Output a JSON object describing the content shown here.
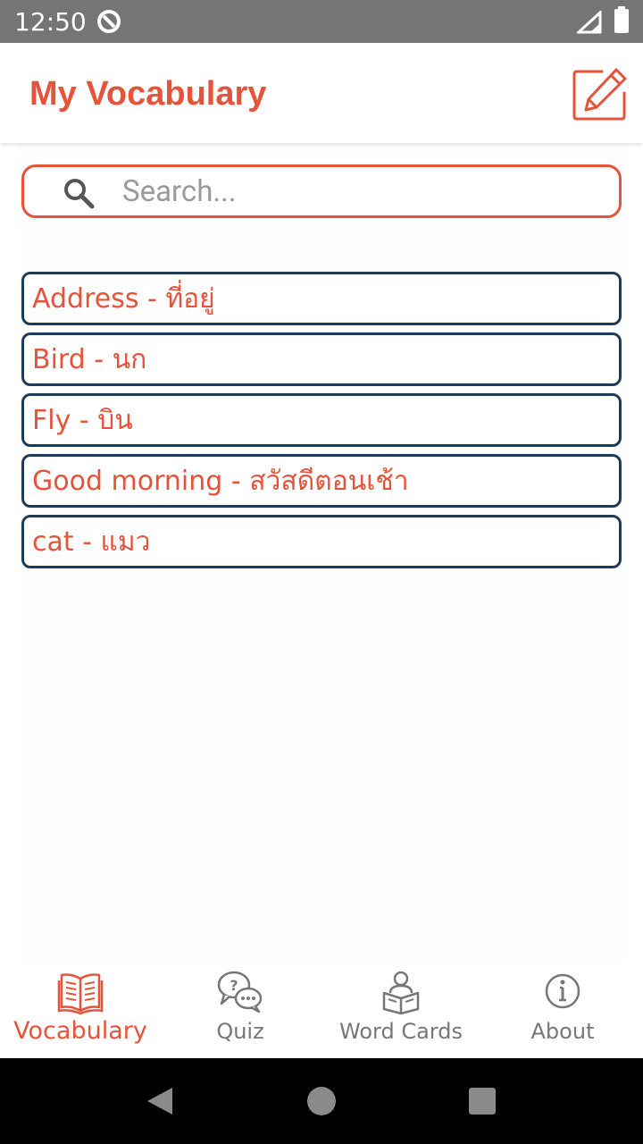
{
  "status_bar": {
    "time": "12:50",
    "icons": [
      "app-notification-icon",
      "signal-icon",
      "battery-icon"
    ]
  },
  "app_bar": {
    "title": "My Vocabulary",
    "action_icon": "edit-icon"
  },
  "search": {
    "placeholder": "Search...",
    "value": "",
    "icon": "search-icon"
  },
  "words": [
    {
      "label": "Address - ที่อยู่"
    },
    {
      "label": "Bird - นก"
    },
    {
      "label": "Fly - บิน"
    },
    {
      "label": "Good morning - สวัสดีตอนเช้า"
    },
    {
      "label": "cat - แมว"
    }
  ],
  "bottom_nav": {
    "items": [
      {
        "label": "Vocabulary",
        "icon": "open-book-icon",
        "active": true
      },
      {
        "label": "Quiz",
        "icon": "chat-bubbles-icon",
        "active": false
      },
      {
        "label": "Word Cards",
        "icon": "reader-icon",
        "active": false
      },
      {
        "label": "About",
        "icon": "info-icon",
        "active": false
      }
    ]
  },
  "system_nav": {
    "icons": [
      "back-icon",
      "home-icon",
      "recents-icon"
    ]
  },
  "colors": {
    "accent": "#e4533a",
    "item_border": "#1e3a57",
    "nav_inactive": "#777777",
    "status_bar": "#757575"
  }
}
